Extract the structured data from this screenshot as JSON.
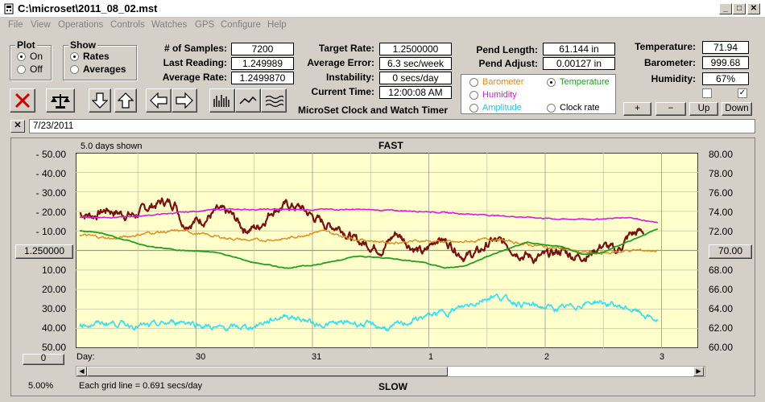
{
  "window": {
    "title": "C:\\microset\\2011_08_02.mst",
    "min_glyph": "_",
    "max_glyph": "□",
    "close_glyph": "✕"
  },
  "menu": [
    "File",
    "View",
    "Operations",
    "Controls",
    "Watches",
    "GPS",
    "Configure",
    "Help"
  ],
  "plot_group": {
    "title": "Plot",
    "on": "On",
    "off": "Off",
    "selected": "On"
  },
  "show_group": {
    "title": "Show",
    "rates": "Rates",
    "averages": "Averages",
    "selected": "Rates"
  },
  "stats": {
    "samples_label": "# of Samples:",
    "samples": "7200",
    "last_reading_label": "Last Reading:",
    "last_reading": "1.249989",
    "average_rate_label": "Average Rate:",
    "average_rate": "1.2499870",
    "target_rate_label": "Target Rate:",
    "target_rate": "1.2500000",
    "average_error_label": "Average Error:",
    "average_error": "6.3 sec/week",
    "instability_label": "Instability:",
    "instability": "0 secs/day",
    "current_time_label": "Current Time:",
    "current_time": "12:00:08 AM",
    "app_caption": "MicroSet Clock and Watch Timer",
    "pend_length_label": "Pend Length:",
    "pend_length": "61.144 in",
    "pend_adjust_label": "Pend Adjust:",
    "pend_adjust": "0.00127 in",
    "temperature_label": "Temperature:",
    "temperature": "71.94",
    "barometer_label": "Barometer:",
    "barometer": "999.68",
    "humidity_label": "Humidity:",
    "humidity": "67%"
  },
  "sensor_select": {
    "barometer": "Barometer",
    "temperature": "Temperature",
    "humidity": "Humidity",
    "amplitude": "Amplitude",
    "clock_rate": "Clock rate",
    "selected": "Temperature"
  },
  "right_buttons": {
    "plus": "+",
    "minus": "−",
    "up": "Up",
    "down": "Down"
  },
  "date_bar": {
    "close_glyph": "✕",
    "date": "7/23/2011"
  },
  "chart_data": {
    "type": "line",
    "top_label": "FAST",
    "bottom_label": "SLOW",
    "days_shown": "5.0 days shown",
    "grid_note": "Each grid line = 0.691 secs/day",
    "zoom": "5.00%",
    "center_rate": "1.250000",
    "center_temp": "70.00",
    "scroll_value": "0",
    "bottom_left_value": "50.00",
    "x_label": "Day:",
    "x_ticks": [
      "30",
      "31",
      "1",
      "2",
      "3"
    ],
    "y_left_ticks": [
      "- 50.00",
      "- 40.00",
      "- 30.00",
      "- 20.00",
      "- 10.00",
      "10.00",
      "20.00",
      "30.00",
      "40.00"
    ],
    "y_right_ticks": [
      "80.00",
      "78.00",
      "76.00",
      "74.00",
      "72.00",
      "68.00",
      "66.00",
      "64.00",
      "62.00",
      "60.00"
    ],
    "ylim_left": [
      -50,
      50
    ],
    "ylim_right": [
      60,
      80
    ],
    "xlim_days": [
      0,
      5.0
    ],
    "series": [
      {
        "name": "Clock rate",
        "color": "#7a1010",
        "width": 2.2,
        "noise": 3.5,
        "points": [
          [
            0,
            19
          ],
          [
            0.2,
            18
          ],
          [
            0.4,
            21
          ],
          [
            0.6,
            19
          ],
          [
            0.8,
            18
          ],
          [
            1.0,
            22
          ],
          [
            1.2,
            25
          ],
          [
            1.4,
            24
          ],
          [
            1.5,
            14
          ],
          [
            1.8,
            16
          ],
          [
            2.0,
            20
          ],
          [
            2.2,
            18
          ],
          [
            2.4,
            11
          ],
          [
            2.6,
            12
          ],
          [
            2.8,
            21
          ],
          [
            3.0,
            23
          ],
          [
            3.2,
            22
          ],
          [
            3.4,
            17
          ],
          [
            3.6,
            13
          ],
          [
            3.8,
            12
          ],
          [
            4.0,
            5
          ],
          [
            4.2,
            3
          ],
          [
            4.4,
            1
          ],
          [
            4.6,
            9
          ],
          [
            4.8,
            3
          ],
          [
            5.0,
            -2
          ],
          [
            5.2,
            7
          ],
          [
            5.4,
            3
          ],
          [
            5.6,
            -3
          ],
          [
            5.8,
            -1
          ],
          [
            6.0,
            5
          ],
          [
            6.2,
            3
          ],
          [
            6.4,
            -1
          ],
          [
            6.6,
            -4
          ],
          [
            6.8,
            -3
          ],
          [
            7.0,
            0
          ],
          [
            7.2,
            -3
          ],
          [
            7.4,
            -2
          ],
          [
            7.6,
            3
          ],
          [
            7.8,
            -1
          ],
          [
            8.0,
            8
          ],
          [
            8.2,
            10
          ]
        ]
      },
      {
        "name": "Humidity",
        "color": "#d81ed8",
        "width": 1.6,
        "noise": 0.4,
        "points": [
          [
            0,
            17
          ],
          [
            0.6,
            17
          ],
          [
            1.0,
            18
          ],
          [
            2.0,
            21
          ],
          [
            3.0,
            21
          ],
          [
            4.0,
            21
          ],
          [
            5.0,
            20
          ],
          [
            6.0,
            18
          ],
          [
            7.0,
            16
          ],
          [
            7.5,
            16
          ],
          [
            8.0,
            17
          ],
          [
            8.4,
            14
          ]
        ]
      },
      {
        "name": "Barometer",
        "color": "#e08a1a",
        "width": 1.4,
        "noise": 1.0,
        "points": [
          [
            0,
            8
          ],
          [
            0.5,
            6
          ],
          [
            1.0,
            9
          ],
          [
            1.5,
            10
          ],
          [
            2.0,
            7
          ],
          [
            2.5,
            5
          ],
          [
            3.0,
            6
          ],
          [
            3.5,
            10
          ],
          [
            4.0,
            6
          ],
          [
            4.5,
            4
          ],
          [
            5.0,
            5
          ],
          [
            5.5,
            4
          ],
          [
            6.0,
            6
          ],
          [
            6.5,
            3
          ],
          [
            7.0,
            1
          ],
          [
            7.5,
            -2
          ],
          [
            8.0,
            0
          ],
          [
            8.4,
            0
          ]
        ]
      },
      {
        "name": "Temperature",
        "color": "#20a020",
        "width": 1.8,
        "noise": 0.3,
        "points": [
          [
            0,
            10
          ],
          [
            0.3,
            9
          ],
          [
            0.6,
            6
          ],
          [
            1.0,
            2
          ],
          [
            1.5,
            0
          ],
          [
            2.0,
            -1
          ],
          [
            2.5,
            -6
          ],
          [
            3.0,
            -9
          ],
          [
            3.5,
            -7
          ],
          [
            4.0,
            -3
          ],
          [
            4.5,
            -4
          ],
          [
            5.0,
            -6
          ],
          [
            5.3,
            -9
          ],
          [
            5.6,
            -8
          ],
          [
            6.0,
            -2
          ],
          [
            6.5,
            4
          ],
          [
            7.0,
            2
          ],
          [
            7.3,
            -2
          ],
          [
            7.6,
            -1
          ],
          [
            8.0,
            5
          ],
          [
            8.4,
            11
          ]
        ]
      },
      {
        "name": "Amplitude",
        "color": "#30e0f0",
        "width": 1.6,
        "noise": 2.2,
        "points": [
          [
            0,
            -38
          ],
          [
            0.5,
            -37
          ],
          [
            1.0,
            -39
          ],
          [
            1.5,
            -36
          ],
          [
            2.0,
            -40
          ],
          [
            2.5,
            -39
          ],
          [
            3.0,
            -33
          ],
          [
            3.5,
            -38
          ],
          [
            4.0,
            -37
          ],
          [
            4.5,
            -40
          ],
          [
            5.0,
            -34
          ],
          [
            5.5,
            -30
          ],
          [
            6.0,
            -23
          ],
          [
            6.5,
            -28
          ],
          [
            7.0,
            -30
          ],
          [
            7.5,
            -26
          ],
          [
            8.0,
            -30
          ],
          [
            8.4,
            -36
          ]
        ]
      }
    ]
  }
}
